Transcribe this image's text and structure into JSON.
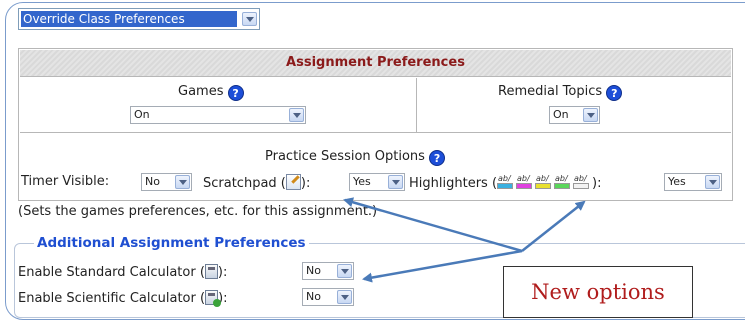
{
  "override_select": {
    "value": "Override Class Preferences"
  },
  "table": {
    "title": "Assignment Preferences",
    "games": {
      "label": "Games",
      "value": "On"
    },
    "remedial": {
      "label": "Remedial Topics",
      "value": "On"
    },
    "practice": {
      "title": "Practice Session Options",
      "timer_label": "Timer Visible:",
      "timer_value": "No",
      "scratchpad_label": "Scratchpad (",
      "scratchpad_suffix": "):",
      "scratchpad_value": "Yes",
      "highlighters_label": "Highlighters (",
      "highlighters_suffix": "):",
      "highlighters_value": "Yes",
      "highlighter_colors": [
        "#3ab0e0",
        "#e040e0",
        "#e8e030",
        "#5bd65b",
        "#f3f3f3"
      ],
      "highlighter_glyph": "ab/"
    }
  },
  "note": "(Sets the games preferences, etc. for this assignment.)",
  "additional": {
    "legend": "Additional Assignment Preferences",
    "standard_label": "Enable Standard Calculator (",
    "standard_suffix": "):",
    "standard_value": "No",
    "scientific_label": "Enable Scientific Calculator (",
    "scientific_suffix": "):",
    "scientific_value": "No"
  },
  "callout": {
    "text": "New options"
  },
  "colors": {
    "accent": "#1f4fd1",
    "header_text": "#8b1a1a",
    "callout_text": "#b01c1c",
    "arrow": "#4a7ab8"
  }
}
